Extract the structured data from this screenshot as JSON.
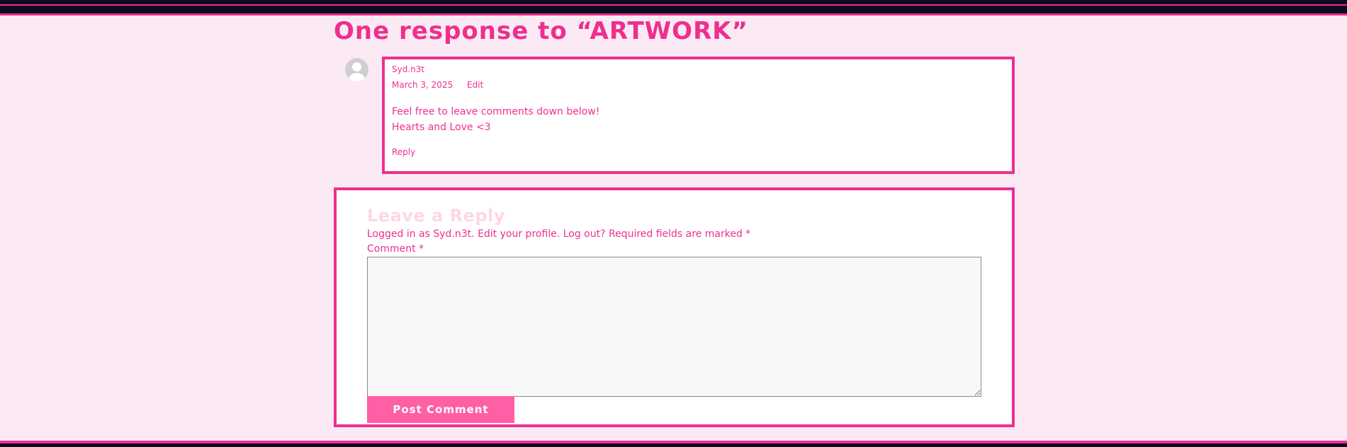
{
  "comments": {
    "title": "One response to “ARTWORK”",
    "items": [
      {
        "author": "Syd.n3t",
        "date": "March 3, 2025",
        "edit_label": "Edit",
        "body_lines": [
          "Feel free to leave comments down below!",
          "Hearts and Love <3"
        ],
        "reply_label": "Reply"
      }
    ]
  },
  "respond": {
    "title": "Leave a Reply",
    "logged_in_prefix": "Logged in as Syd.n3t.",
    "edit_profile": "Edit your profile.",
    "log_out": "Log out?",
    "required_note": "Required fields are marked *",
    "comment_label": "Comment *",
    "comment_value": "",
    "submit_label": "Post Comment"
  },
  "colors": {
    "accent": "#ee2f8f",
    "button": "#ff5fa5",
    "background": "#fbeaf3",
    "bar": "#0e0a1d",
    "reply_title": "#fcd8e3"
  },
  "icons": {
    "avatar": "default-avatar-icon"
  }
}
